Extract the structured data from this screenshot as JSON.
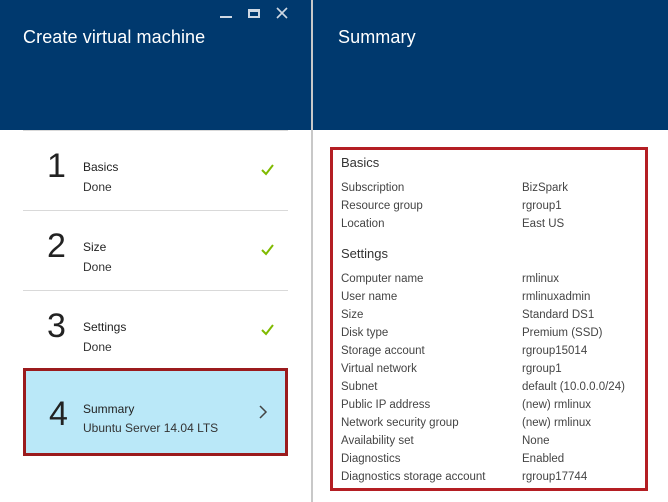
{
  "left_blade": {
    "title": "Create virtual machine",
    "steps": [
      {
        "number": "1",
        "title": "Basics",
        "status": "Done",
        "complete": true
      },
      {
        "number": "2",
        "title": "Size",
        "status": "Done",
        "complete": true
      },
      {
        "number": "3",
        "title": "Settings",
        "status": "Done",
        "complete": true
      },
      {
        "number": "4",
        "title": "Summary",
        "status": "Ubuntu Server 14.04 LTS",
        "active": true
      }
    ]
  },
  "right_blade": {
    "title": "Summary",
    "basics": {
      "heading": "Basics",
      "rows": [
        {
          "label": "Subscription",
          "value": "BizSpark"
        },
        {
          "label": "Resource group",
          "value": "rgroup1"
        },
        {
          "label": "Location",
          "value": "East US"
        }
      ]
    },
    "settings": {
      "heading": "Settings",
      "rows": [
        {
          "label": "Computer name",
          "value": "rmlinux"
        },
        {
          "label": "User name",
          "value": "rmlinuxadmin"
        },
        {
          "label": "Size",
          "value": "Standard DS1"
        },
        {
          "label": "Disk type",
          "value": "Premium (SSD)"
        },
        {
          "label": "Storage account",
          "value": "rgroup15014"
        },
        {
          "label": "Virtual network",
          "value": "rgroup1"
        },
        {
          "label": "Subnet",
          "value": "default (10.0.0.0/24)"
        },
        {
          "label": "Public IP address",
          "value": "(new) rmlinux"
        },
        {
          "label": "Network security group",
          "value": "(new) rmlinux"
        },
        {
          "label": "Availability set",
          "value": "None"
        },
        {
          "label": "Diagnostics",
          "value": "Enabled"
        },
        {
          "label": "Diagnostics storage account",
          "value": "rgroup17744"
        }
      ]
    }
  },
  "colors": {
    "header": "#00396e",
    "active_step": "#bae8f8",
    "highlight_border": "#b41e23",
    "check": "#7fba00"
  },
  "icons": [
    "minimize-icon",
    "maximize-icon",
    "close-icon",
    "checkmark-icon",
    "chevron-right-icon"
  ]
}
